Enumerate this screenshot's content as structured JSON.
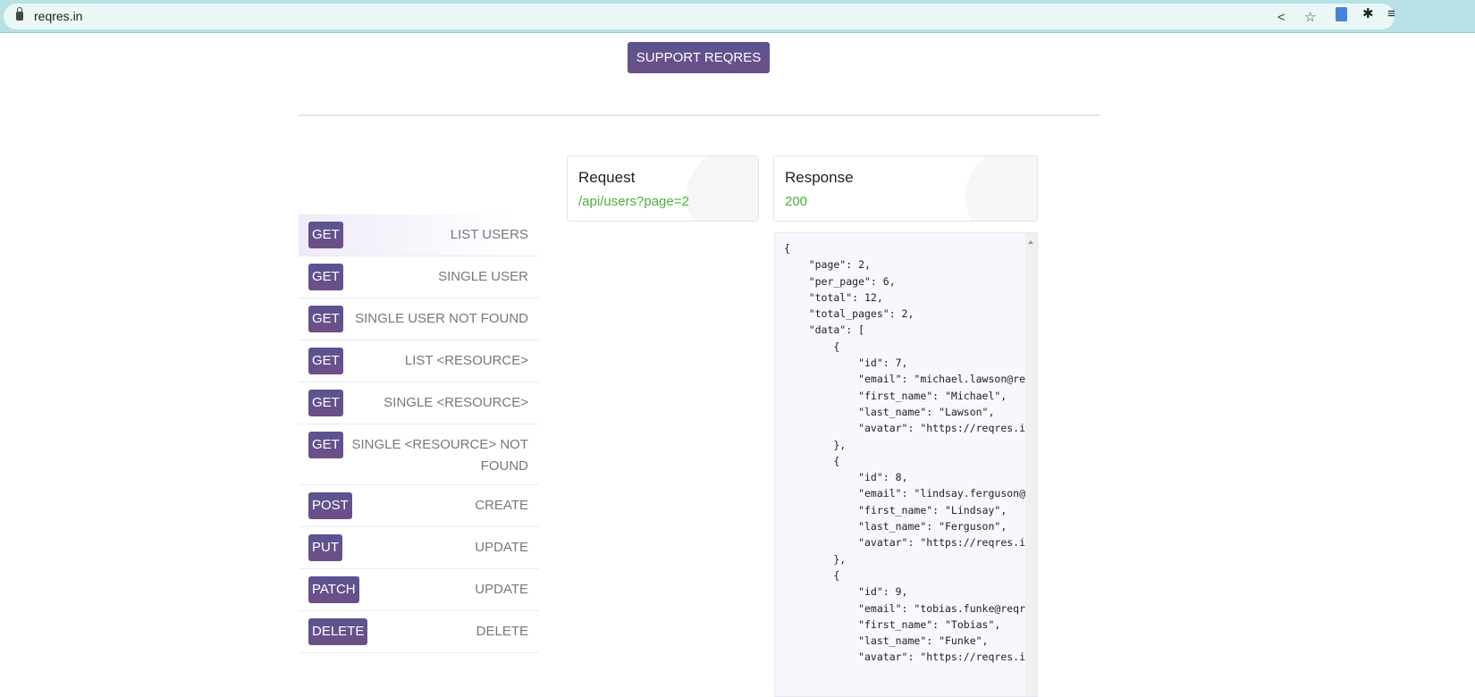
{
  "browser": {
    "url": "reqres.in"
  },
  "support_label": "SUPPORT REQRES",
  "endpoints": [
    {
      "method": "GET",
      "label": "LIST USERS"
    },
    {
      "method": "GET",
      "label": "SINGLE USER"
    },
    {
      "method": "GET",
      "label": "SINGLE USER NOT FOUND"
    },
    {
      "method": "GET",
      "label": "LIST <RESOURCE>"
    },
    {
      "method": "GET",
      "label": "SINGLE <RESOURCE>"
    },
    {
      "method": "GET",
      "label": "SINGLE <RESOURCE> NOT FOUND"
    },
    {
      "method": "POST",
      "label": "CREATE"
    },
    {
      "method": "PUT",
      "label": "UPDATE"
    },
    {
      "method": "PATCH",
      "label": "UPDATE"
    },
    {
      "method": "DELETE",
      "label": "DELETE"
    }
  ],
  "request": {
    "title": "Request",
    "value": "/api/users?page=2"
  },
  "response": {
    "title": "Response",
    "value": "200",
    "body": "{\n    \"page\": 2,\n    \"per_page\": 6,\n    \"total\": 12,\n    \"total_pages\": 2,\n    \"data\": [\n        {\n            \"id\": 7,\n            \"email\": \"michael.lawson@reqr\n            \"first_name\": \"Michael\",\n            \"last_name\": \"Lawson\",\n            \"avatar\": \"https://reqres.in/\n        },\n        {\n            \"id\": 8,\n            \"email\": \"lindsay.ferguson@re\n            \"first_name\": \"Lindsay\",\n            \"last_name\": \"Ferguson\",\n            \"avatar\": \"https://reqres.in/\n        },\n        {\n            \"id\": 9,\n            \"email\": \"tobias.funke@reqres\n            \"first_name\": \"Tobias\",\n            \"last_name\": \"Funke\",\n            \"avatar\": \"https://reqres.in/"
  }
}
